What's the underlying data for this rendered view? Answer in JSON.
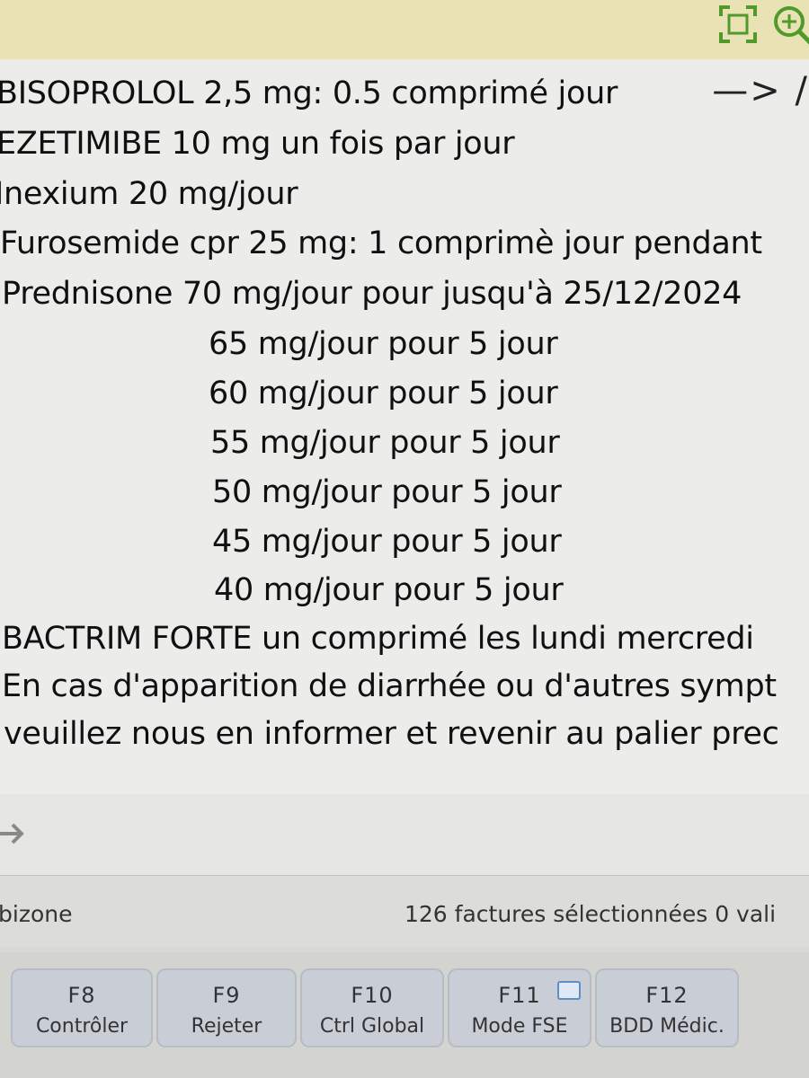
{
  "editor": {
    "lines": [
      "BISOPROLOL 2,5 mg: 0.5 comprimé jour",
      "EZETIMIBE 10 mg un fois par jour",
      "Inexium 20 mg/jour",
      "Furosemide cpr 25 mg: 1 comprimè jour pendant",
      "Prednisone 70 mg/jour pour jusqu'à 25/12/2024",
      "65 mg/jour pour 5 jour",
      "60 mg/jour pour 5 jour",
      "55 mg/jour pour 5 jour",
      "50 mg/jour pour 5 jour",
      "45 mg/jour pour 5 jour",
      "40 mg/jour pour 5 jour",
      "BACTRIM FORTE un comprimé les lundi mercredi",
      "En cas d'apparition de diarrhée ou d'autres sympt",
      "veuillez nous en informer et revenir au palier prec"
    ],
    "arrow_text": "—> /"
  },
  "status": {
    "left_text": "bizone",
    "right_text": "126 factures sélectionnées  0 vali"
  },
  "function_keys": [
    {
      "key": "F8",
      "label": "Contrôler"
    },
    {
      "key": "F9",
      "label": "Rejeter"
    },
    {
      "key": "F10",
      "label": "Ctrl Global"
    },
    {
      "key": "F11",
      "label": "Mode FSE"
    },
    {
      "key": "F12",
      "label": "BDD Médic."
    }
  ],
  "icons": {
    "toolbar": [
      "fit-screen-icon",
      "zoom-in-icon"
    ],
    "input": "arrow-right-icon",
    "f11": "screen-icon"
  },
  "colors": {
    "toolbar_icon": "#4f9a2a",
    "top_strip": "#e9e2b4",
    "fkey_bg": "#c9cdd6"
  }
}
